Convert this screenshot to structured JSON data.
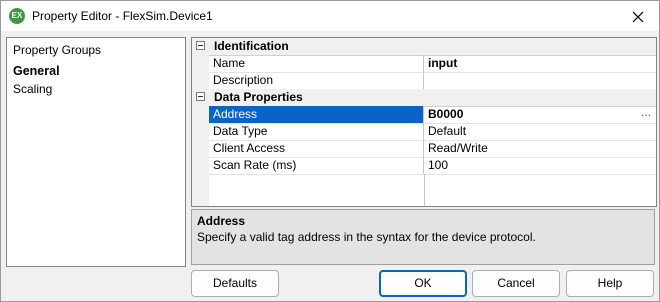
{
  "window": {
    "title": "Property Editor - FlexSim.Device1",
    "icon_text": "EX",
    "icon_color": "#3c9a3c"
  },
  "groups": {
    "title": "Property Groups",
    "items": [
      {
        "label": "General",
        "selected": true
      },
      {
        "label": "Scaling",
        "selected": false
      }
    ]
  },
  "grid": {
    "categories": [
      {
        "label": "Identification",
        "properties": [
          {
            "name": "Name",
            "value": "input",
            "bold": true
          },
          {
            "name": "Description",
            "value": ""
          }
        ]
      },
      {
        "label": "Data Properties",
        "properties": [
          {
            "name": "Address",
            "value": "B0000",
            "bold": true,
            "selected": true,
            "ellipsis": "..."
          },
          {
            "name": "Data Type",
            "value": "Default"
          },
          {
            "name": "Client Access",
            "value": "Read/Write"
          },
          {
            "name": "Scan Rate (ms)",
            "value": "100"
          }
        ]
      }
    ],
    "selection_color": "#0a64c8"
  },
  "description": {
    "title": "Address",
    "text": "Specify a valid tag address in the syntax for the device protocol."
  },
  "buttons": {
    "defaults": "Defaults",
    "ok": "OK",
    "cancel": "Cancel",
    "help": "Help"
  }
}
